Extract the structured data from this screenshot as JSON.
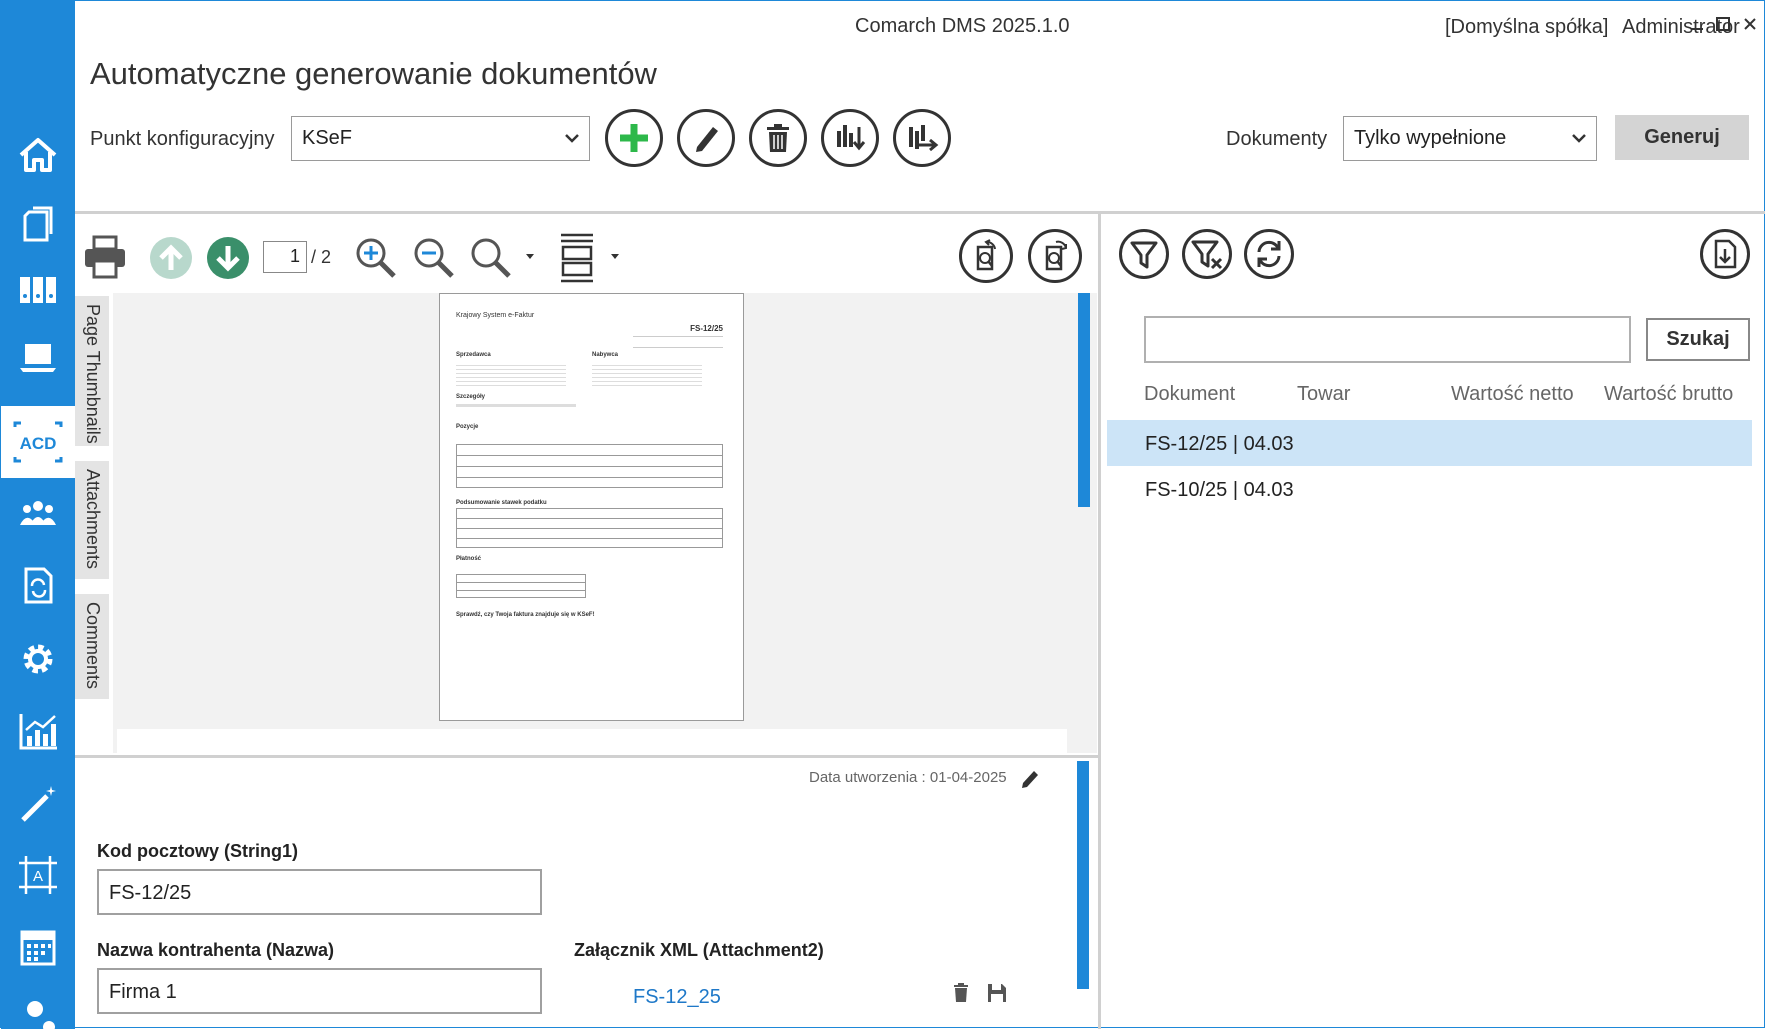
{
  "window": {
    "title": "Comarch DMS 2025.1.0",
    "company": "[Domyślna spółka]",
    "user": "Administrator"
  },
  "page": {
    "title": "Automatyczne generowanie dokumentów"
  },
  "sidebar": {
    "items": [
      "home-icon",
      "documents-icon",
      "binders-icon",
      "laptop-icon",
      "acd-icon",
      "users-icon",
      "document-sync-icon",
      "gear-icon",
      "chart-icon",
      "magic-wand-icon",
      "template-icon",
      "calendar-icon",
      "user-settings-icon"
    ],
    "acd_label": "ACD"
  },
  "toolbar": {
    "config_label": "Punkt konfiguracyjny",
    "config_value": "KSeF",
    "docs_label": "Dokumenty",
    "docs_value": "Tylko wypełnione",
    "generate_label": "Generuj"
  },
  "viewer": {
    "page_current": "1",
    "page_total": "/ 2",
    "tabs": [
      "Page Thumbnails",
      "Attachments",
      "Comments"
    ]
  },
  "preview": {
    "brand": "Krajowy System e-Faktur",
    "invoice_no": "FS-12/25",
    "seller": "Sprzedawca",
    "buyer": "Nabywca",
    "details": "Szczegóły",
    "positions": "Pozycje",
    "vat_summary": "Podsumowanie stawek podatku",
    "payment": "Płatność",
    "footer": "Sprawdź, czy Twoja faktura znajduje się w KSeF!"
  },
  "form": {
    "created_date": "Data utworzenia : 01-04-2025",
    "postal_label": "Kod pocztowy (String1)",
    "postal_value": "FS-12/25",
    "contractor_label": "Nazwa kontrahenta (Nazwa)",
    "contractor_value": "Firma 1",
    "xml_label": "Załącznik XML (Attachment2)",
    "xml_link": "FS-12_25"
  },
  "list": {
    "search_button": "Szukaj",
    "search_value": "",
    "columns": [
      "Dokument",
      "Towar",
      "Wartość netto",
      "Wartość brutto"
    ],
    "rows": [
      {
        "label": "FS-12/25 | 04.03",
        "selected": true
      },
      {
        "label": "FS-10/25 | 04.03",
        "selected": false
      }
    ]
  },
  "colors": {
    "accent": "#1e88d8",
    "add_green": "#2db84a",
    "selected_row": "#cce4f7"
  }
}
